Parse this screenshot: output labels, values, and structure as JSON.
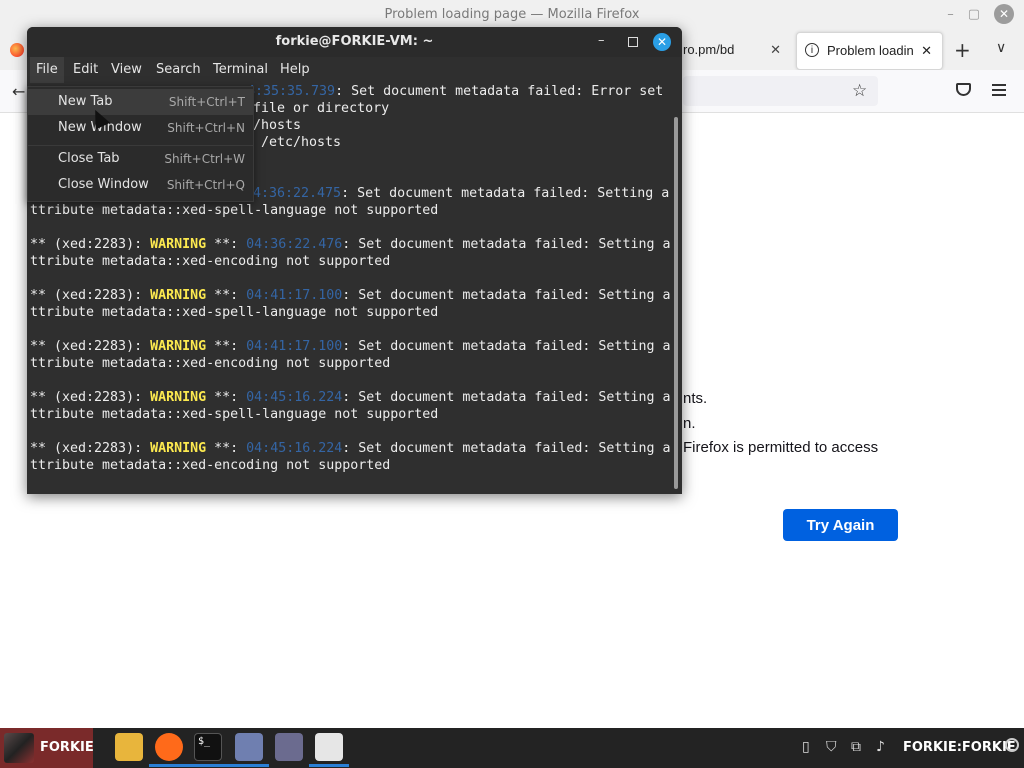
{
  "firefox": {
    "window_title": "Problem loading page — Mozilla Firefox",
    "tabs": [
      {
        "label": "ro.pm/bd",
        "close": "✕"
      },
      {
        "label": "Problem loadin",
        "close": "✕"
      }
    ],
    "new_tab": "+",
    "tab_list": "∨",
    "back": "←",
    "star": "☆",
    "win_min": "–",
    "win_max": "▢",
    "win_close": "✕",
    "body_lines": [
      "nts.",
      "n.",
      " Firefox is permitted to access"
    ],
    "try_again_label": "Try Again"
  },
  "terminal": {
    "title": "forkie@FORKIE-VM: ~",
    "min": "–",
    "close": "✕",
    "menu": [
      "File",
      "Edit",
      "View",
      "Search",
      "Terminal",
      "Help"
    ],
    "lines": {
      "l0_ts": "4:35:35.739",
      "l0_rest": ": Set document metadata failed: Error set",
      "l1": "file or directory",
      "l2": "/hosts",
      "l3": " /etc/hosts",
      "l4_ts": "04:36:22.475",
      "l4_rest": ": Set document metadata failed: Setting a",
      "l5": "ttribute metadata::xed-spell-language not supported",
      "prefix": "** (xed:2283): ",
      "warning": "WARNING",
      "stars": " **: ",
      "b1_ts": "04:36:22.476",
      "b1_rest": ": Set document metadata failed: Setting a",
      "b1_l2": "ttribute metadata::xed-encoding not supported",
      "b2_ts": "04:41:17.100",
      "b2_rest": ": Set document metadata failed: Setting a",
      "b2_l2": "ttribute metadata::xed-spell-language not supported",
      "b3_ts": "04:41:17.100",
      "b3_rest": ": Set document metadata failed: Setting a",
      "b3_l2": "ttribute metadata::xed-encoding not supported",
      "b4_ts": "04:45:16.224",
      "b4_rest": ": Set document metadata failed: Setting a",
      "b4_l2": "ttribute metadata::xed-spell-language not supported",
      "b5_ts": "04:45:16.224",
      "b5_rest": ": Set document metadata failed: Setting a",
      "b5_l2": "ttribute metadata::xed-encoding not supported"
    }
  },
  "file_menu": {
    "items": [
      {
        "label": "New Tab",
        "accel": "Shift+Ctrl+T"
      },
      {
        "label": "New Window",
        "accel": "Shift+Ctrl+N"
      },
      {
        "label": "Close Tab",
        "accel": "Shift+Ctrl+W"
      },
      {
        "label": "Close Window",
        "accel": "Shift+Ctrl+Q"
      }
    ]
  },
  "taskbar": {
    "start_label": "FORKIE",
    "user_label": "FORKIE:FORKIE",
    "terminal_icon_text": "$_"
  }
}
